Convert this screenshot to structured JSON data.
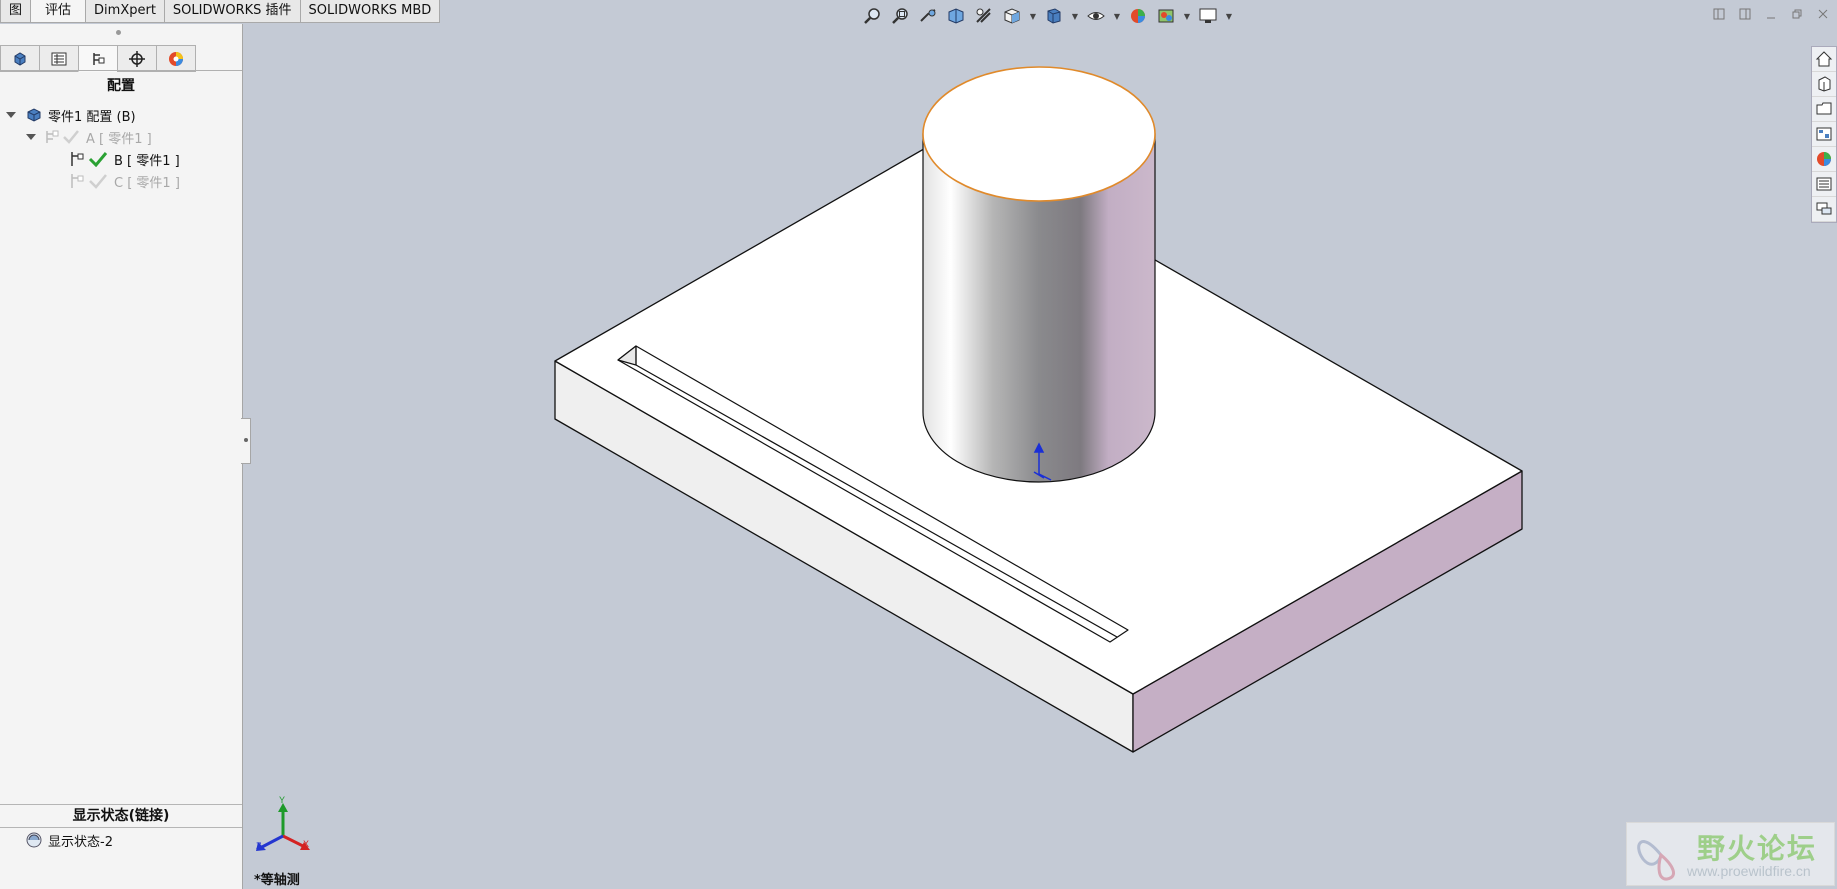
{
  "tabs": [
    {
      "label": "图",
      "active": false
    },
    {
      "label": "评估",
      "active": true
    },
    {
      "label": "DimXpert",
      "active": false
    },
    {
      "label": "SOLIDWORKS 插件",
      "active": false
    },
    {
      "label": "SOLIDWORKS MBD",
      "active": false
    }
  ],
  "panel": {
    "tab_icons": [
      "feature-manager-icon",
      "property-manager-icon",
      "configuration-manager-icon",
      "dimxpert-manager-icon",
      "display-manager-icon"
    ],
    "active_tab_index": 2,
    "title": "配置",
    "root": {
      "label": "零件1 配置  (B)"
    },
    "configs": [
      {
        "label": "A [ 零件1 ]",
        "active": false
      },
      {
        "label": "B [ 零件1 ]",
        "active": true
      },
      {
        "label": "C [ 零件1 ]",
        "active": false
      }
    ],
    "display_state_header": "显示状态(链接)",
    "display_state_item": "显示状态-2"
  },
  "viewport": {
    "view_name": "*等轴测",
    "triad_labels": {
      "x": "X",
      "y": "Y",
      "z": "Z"
    },
    "part_colors": {
      "face_top": "#ffffff",
      "face_front": "#efefef",
      "face_right": "#c5afc5",
      "edge": "#111111",
      "cap_edge": "#e08a2b",
      "background": "#c4cad5"
    }
  },
  "toolbar_icons": [
    "zoom-to-fit-icon",
    "zoom-to-area-icon",
    "previous-view-icon",
    "section-view-icon",
    "dynamic-annotation-icon",
    "view-orientation-icon",
    "display-style-icon",
    "hide-show-items-icon",
    "edit-appearance-icon",
    "apply-scene-icon",
    "view-settings-icon"
  ],
  "window_controls": [
    "tile-left-icon",
    "tile-right-icon",
    "minimize-icon",
    "restore-icon",
    "close-icon"
  ],
  "task_pane_icons": [
    "solidworks-resources-icon",
    "design-library-icon",
    "file-explorer-icon",
    "view-palette-icon",
    "appearances-icon",
    "custom-properties-icon",
    "forum-icon"
  ],
  "watermark": {
    "title": "野火论坛",
    "url": "www.proewildfire.cn"
  }
}
